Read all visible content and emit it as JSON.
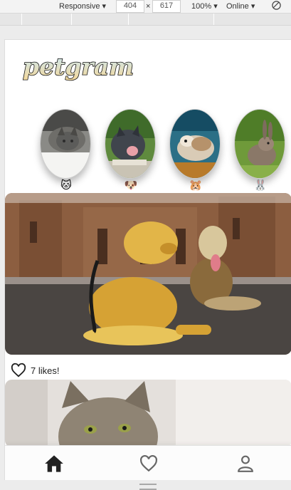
{
  "devtools": {
    "device": "Responsive",
    "width": "404",
    "times": "×",
    "height": "617",
    "zoom": "100%",
    "network": "Online",
    "rotate_icon": "rotate-icon"
  },
  "app": {
    "logo_text": "petgram"
  },
  "stories": [
    {
      "emoji": "🐱",
      "photo_icon": "cat-photo"
    },
    {
      "emoji": "🐶",
      "photo_icon": "dog-photo"
    },
    {
      "emoji": "🐹",
      "photo_icon": "hamster-photo"
    },
    {
      "emoji": "🐰",
      "photo_icon": "rabbit-photo"
    }
  ],
  "post": {
    "likes_text": "7 likes!",
    "photo_icon": "dogs-photo"
  },
  "second_post": {
    "photo_icon": "cat-photo"
  },
  "navbar": {
    "home_icon": "home-icon",
    "favs_icon": "heart-outline-icon",
    "user_icon": "user-icon"
  },
  "colors": {
    "logo_fill_top": "#c8e8f7",
    "logo_fill_bottom": "#f4d89a",
    "icon_dark": "#222222"
  }
}
